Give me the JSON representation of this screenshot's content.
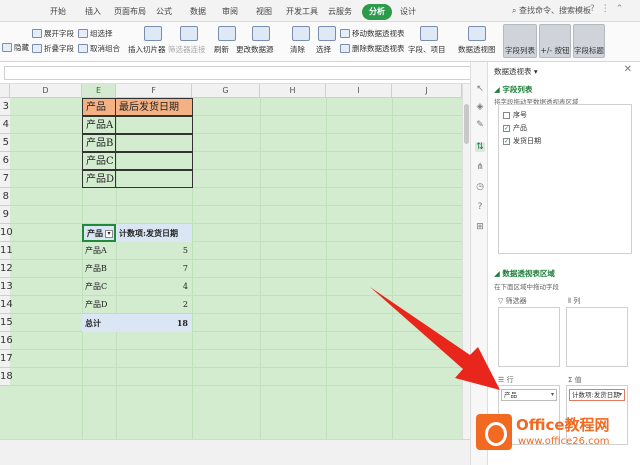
{
  "ribbon_tabs": [
    "开始",
    "插入",
    "页面布局",
    "公式",
    "数据",
    "审阅",
    "视图",
    "开发工具",
    "云服务",
    "分析",
    "设计"
  ],
  "active_tab": "分析",
  "search_label": "查找命令、搜索模板",
  "ribbon": {
    "hide": "隐藏",
    "expand_field": "展开字段",
    "collapse_field": "折叠字段",
    "group_select": "组选择",
    "ungroup": "取消组合",
    "insert_slicer": "插入切片器",
    "filter_connect": "筛选器连接",
    "refresh": "刷新",
    "change_source": "更改数据源",
    "clear": "清除",
    "select": "选择",
    "move_pivot": "移动数据透视表",
    "delete_pivot": "删除数据透视表",
    "field_items": "字段、项目",
    "pivot_chart": "数据透视图",
    "field_list": "字段列表",
    "plus_minus": "+/- 按钮",
    "field_header": "字段标题"
  },
  "sheet": {
    "columns": [
      "E",
      "F",
      "G",
      "H",
      "I",
      "J"
    ],
    "col_d": "D",
    "row_numbers": [
      "3",
      "4",
      "5",
      "6",
      "7",
      "8",
      "9",
      "10",
      "11",
      "12",
      "13",
      "14",
      "15",
      "16",
      "17",
      "18"
    ],
    "source_header": {
      "product": "产品",
      "last_ship": "最后发货日期"
    },
    "source_products": [
      "产品A",
      "产品B",
      "产品C",
      "产品D"
    ],
    "pivot": {
      "row_header": "产品",
      "value_header": "计数项:发货日期",
      "rows": [
        {
          "name": "产品A",
          "count": "5"
        },
        {
          "name": "产品B",
          "count": "7"
        },
        {
          "name": "产品C",
          "count": "4"
        },
        {
          "name": "产品D",
          "count": "2"
        }
      ],
      "total_label": "总计",
      "total_value": "18"
    }
  },
  "pane": {
    "title": "数据透视表",
    "field_list_title": "字段列表",
    "field_list_hint": "将字段拖动至数据透视表区域",
    "fields": [
      {
        "name": "序号",
        "checked": false
      },
      {
        "name": "产品",
        "checked": true
      },
      {
        "name": "发货日期",
        "checked": true
      }
    ],
    "areas_title": "数据透视表区域",
    "areas_hint": "在下面区域中拖动字段",
    "filter_label": "筛选器",
    "column_label": "列",
    "row_label": "行",
    "value_label": "值",
    "row_item": "产品",
    "value_item": "计数项:发货日期"
  },
  "logo": {
    "text": "Office教程网",
    "url": "www.office26.com"
  },
  "colors": {
    "accent": "#2e9b4b",
    "sheet_bg": "#d3ecd0",
    "header_orange": "#f4b183",
    "arrow_red": "#e8261c",
    "logo_orange": "#f26a21"
  }
}
